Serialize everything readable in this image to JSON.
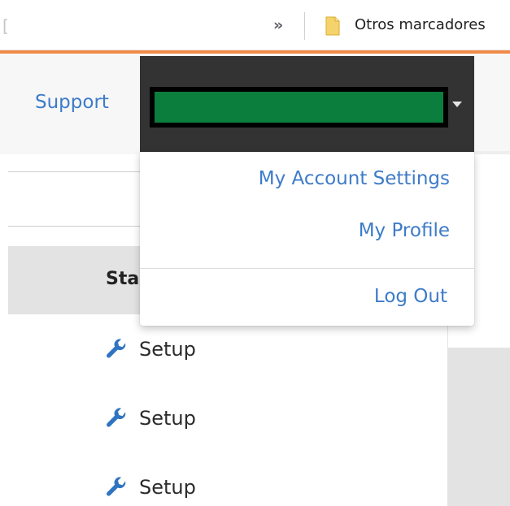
{
  "browser": {
    "bookmarks_bar": {
      "overflow_glyph": "»",
      "folder_label": "Otros marcadores"
    }
  },
  "header": {
    "support_label": "Support",
    "user_menu": {
      "name_redacted": true,
      "redaction_color": "#0b7d3c"
    }
  },
  "dropdown": {
    "items": [
      {
        "label": "My Account Settings"
      },
      {
        "label": "My Profile"
      },
      {
        "label": "Log Out"
      }
    ]
  },
  "table": {
    "header_label_partial": "Sta",
    "rows": [
      {
        "label": "Setup",
        "icon": "wrench-icon"
      },
      {
        "label": "Setup",
        "icon": "wrench-icon"
      },
      {
        "label": "Setup",
        "icon": "wrench-icon"
      }
    ]
  },
  "colors": {
    "accent": "#f18a48",
    "link": "#3d7bc9",
    "header_dark": "#333333"
  }
}
